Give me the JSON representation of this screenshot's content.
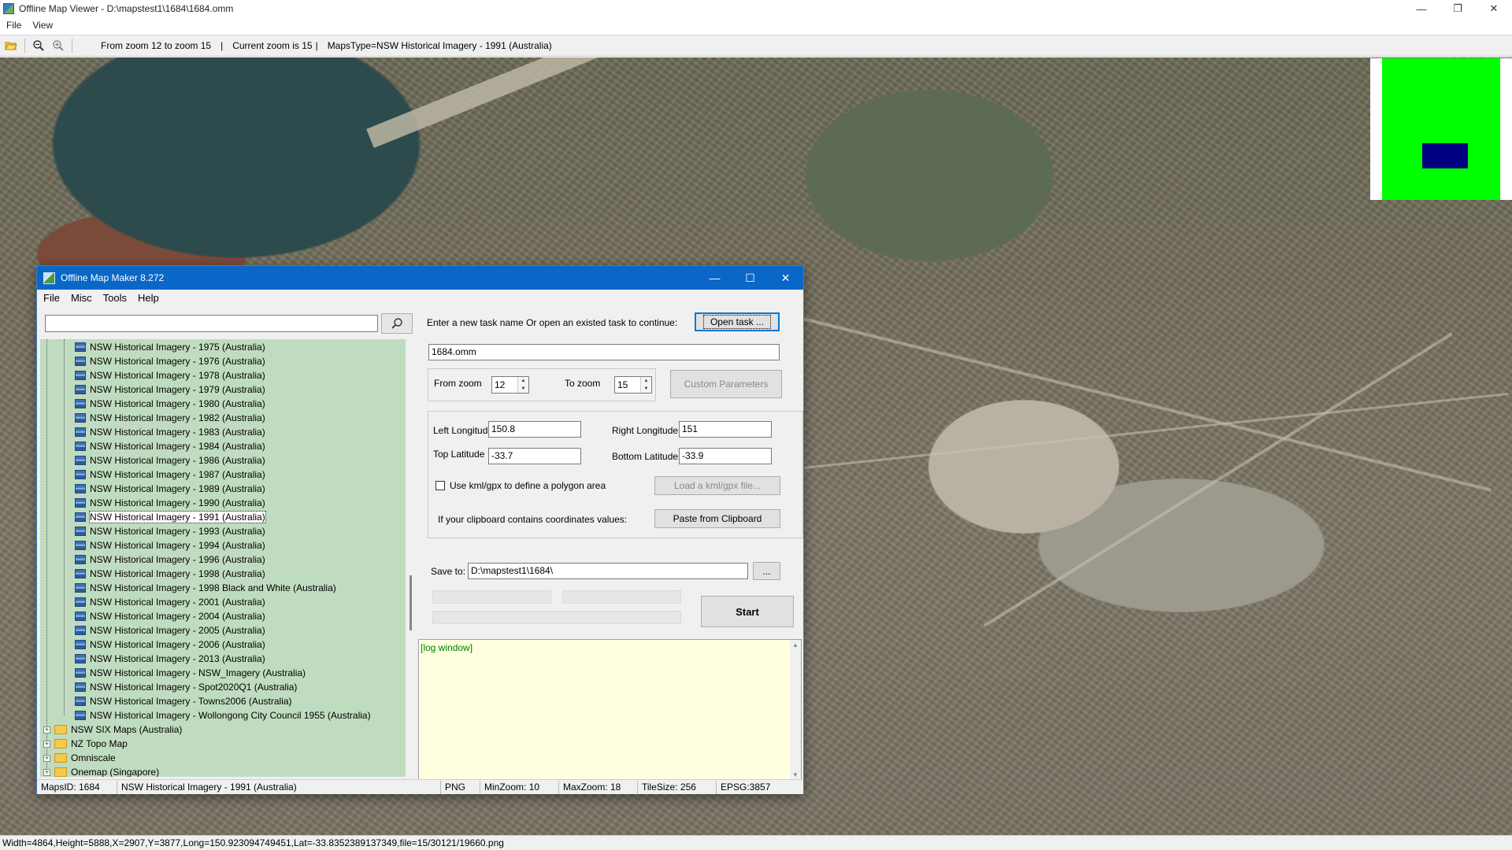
{
  "viewer": {
    "title": "Offline Map Viewer - D:\\mapstest1\\1684\\1684.omm",
    "menu": [
      "File",
      "View"
    ],
    "toolbar": {
      "zoom_range": "From zoom 12 to zoom 15",
      "sep1": "|",
      "current_zoom": "Current zoom is 15",
      "sep2": "|",
      "maps_type": "MapsType=NSW Historical Imagery - 1991 (Australia)"
    },
    "status": "Width=4864,Height=5888,X=2907,Y=3877,Long=150.923094749451,Lat=-33.8352389137349,file=15/30121/19660.png"
  },
  "dialog": {
    "title": "Offline Map Maker 8.272",
    "menu": [
      "File",
      "Misc",
      "Tools",
      "Help"
    ],
    "search": {
      "value": "",
      "placeholder": ""
    },
    "tree": {
      "leaves": [
        "NSW Historical Imagery - 1975 (Australia)",
        "NSW Historical Imagery - 1976 (Australia)",
        "NSW Historical Imagery - 1978 (Australia)",
        "NSW Historical Imagery - 1979 (Australia)",
        "NSW Historical Imagery - 1980 (Australia)",
        "NSW Historical Imagery - 1982 (Australia)",
        "NSW Historical Imagery - 1983 (Australia)",
        "NSW Historical Imagery - 1984 (Australia)",
        "NSW Historical Imagery - 1986 (Australia)",
        "NSW Historical Imagery - 1987 (Australia)",
        "NSW Historical Imagery - 1989 (Australia)",
        "NSW Historical Imagery - 1990 (Australia)",
        "NSW Historical Imagery - 1991 (Australia)",
        "NSW Historical Imagery - 1993 (Australia)",
        "NSW Historical Imagery - 1994 (Australia)",
        "NSW Historical Imagery - 1996 (Australia)",
        "NSW Historical Imagery - 1998 (Australia)",
        "NSW Historical Imagery - 1998 Black and White (Australia)",
        "NSW Historical Imagery - 2001 (Australia)",
        "NSW Historical Imagery - 2004 (Australia)",
        "NSW Historical Imagery - 2005 (Australia)",
        "NSW Historical Imagery - 2006 (Australia)",
        "NSW Historical Imagery - 2013 (Australia)",
        "NSW Historical Imagery - NSW_Imagery (Australia)",
        "NSW Historical Imagery - Spot2020Q1 (Australia)",
        "NSW Historical Imagery - Towns2006 (Australia)",
        "NSW Historical Imagery - Wollongong City Council 1955 (Australia)"
      ],
      "selected": "NSW Historical Imagery - 1991 (Australia)",
      "folders": [
        "NSW SIX Maps (Australia)",
        "NZ Topo Map",
        "Omniscale",
        "Onemap (Singapore)"
      ]
    },
    "task_prompt": "Enter a new task name Or open an existed task to continue:",
    "open_task_btn": "Open task ...",
    "task_name": "1684.omm",
    "from_zoom_label": "From zoom",
    "from_zoom": "12",
    "to_zoom_label": "To zoom",
    "to_zoom": "15",
    "custom_params_btn": "Custom Parameters",
    "left_lon_label": "Left Longitude",
    "left_lon": "150.8",
    "right_lon_label": "Right Longitude",
    "right_lon": "151",
    "top_lat_label": "Top Latitude",
    "top_lat": "-33.7",
    "bottom_lat_label": "Bottom Latitude",
    "bottom_lat": "-33.9",
    "kml_checkbox_label": "Use kml/gpx to define a polygon area",
    "kml_checked": false,
    "load_kml_btn": "Load a kml/gpx file...",
    "clipboard_label": "If your clipboard contains coordinates values:",
    "paste_btn": "Paste from Clipboard",
    "save_to_label": "Save to:",
    "save_to": "D:\\mapstest1\\1684\\",
    "browse_btn": "...",
    "start_btn": "Start",
    "log_text": "[log window]",
    "status": {
      "maps_id": "MapsID: 1684",
      "map_name": "NSW Historical Imagery - 1991 (Australia)",
      "format": "PNG",
      "min_zoom": "MinZoom: 10",
      "max_zoom": "MaxZoom: 18",
      "tile_size": "TileSize: 256",
      "epsg": "EPSG:3857"
    }
  },
  "colors": {
    "dialog_title": "#0a67c8",
    "tree_bg": "#c0dcc0",
    "log_bg": "#ffffe0",
    "overview_green": "#00ff00",
    "overview_box": "#000080"
  }
}
